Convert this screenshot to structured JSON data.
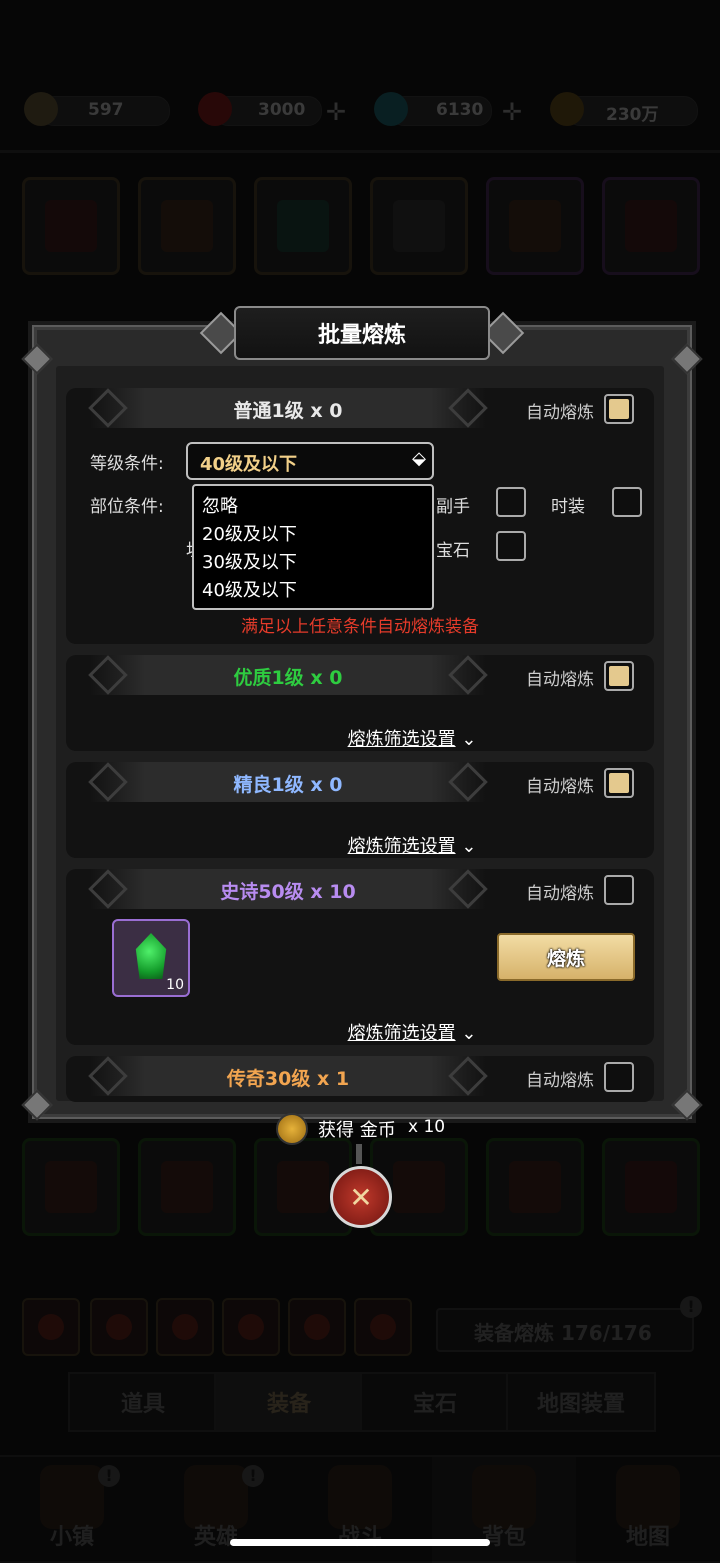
{
  "resources": [
    {
      "icon": "scroll-icon",
      "value": "597"
    },
    {
      "icon": "red-gem-icon",
      "value": "3000"
    },
    {
      "icon": "blue-diamond-icon",
      "value": "6130"
    },
    {
      "icon": "gold-coin-icon",
      "value": "230万"
    }
  ],
  "background": {
    "smelt_bar_label": "装备熔炼 176/176",
    "tabs": [
      "道具",
      "装备",
      "宝石",
      "地图装置"
    ],
    "nav": [
      "小镇",
      "英雄",
      "战斗",
      "背包",
      "地图"
    ]
  },
  "dialog": {
    "title": "批量熔炼",
    "auto_smelt_label": "自动熔炼",
    "sections": {
      "common": {
        "title": "普通1级 x 0",
        "checked": true
      },
      "fine": {
        "title": "优质1级 x 0",
        "checked": true
      },
      "excellent": {
        "title": "精良1级 x 0",
        "checked": true
      },
      "epic": {
        "title": "史诗50级 x 10",
        "checked": false
      },
      "legend": {
        "title": "传奇30级 x 1",
        "checked": false
      }
    },
    "level_condition_label": "等级条件:",
    "slot_condition_label": "部位条件:",
    "level_select_value": "40级及以下",
    "level_options": [
      "忽略",
      "20级及以下",
      "30级及以下",
      "40级及以下"
    ],
    "slot_labels": {
      "offhand": "副手",
      "fashion": "时装",
      "gem": "宝石",
      "hidden_char": "坦"
    },
    "warning": "满足以上任意条件自动熔炼装备",
    "filter_settings": "熔炼筛选设置",
    "epic_item_count": "10",
    "smelt_button": "熔炼",
    "reward_text": "获得 金币",
    "reward_count": "x 10",
    "close_symbol": "✕"
  },
  "colors": {
    "common": "#e8e8e8",
    "fine": "#2ecc40",
    "excellent": "#8fb8ff",
    "epic": "#b88cf0",
    "legend": "#f2a550",
    "warning": "#e53b2a",
    "select_value": "#f2d089"
  }
}
